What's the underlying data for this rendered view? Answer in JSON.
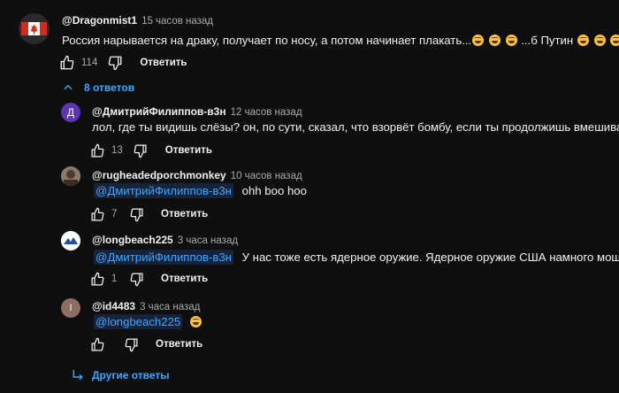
{
  "top_comment": {
    "author": "@Dragonmist1",
    "time": "15 часов назад",
    "text": "Россия нарывается на драку, получает по носу, а потом начинает плакать...",
    "text_tail": "...б Путин",
    "likes": "114",
    "reply_label": "Ответить",
    "avatar_icon": "canada-flag-avatar",
    "toggle_replies_label": "8 ответов"
  },
  "replies": [
    {
      "author": "@ДмитрийФилиппов-в3н",
      "time": "12 часов назад",
      "avatar_letter": "Д",
      "avatar_color": "#5e35b1",
      "mention": "",
      "text": "лол, где ты видишь слёзы? он, по сути, сказал, что взорвёт бомбу, если ты продолжишь вмешиваться",
      "likes": "13",
      "reply_label": "Ответить"
    },
    {
      "author": "@rugheadedporchmonkey",
      "time": "10 часов назад",
      "avatar_icon": "photo-avatar",
      "mention": "@ДмитрийФилиппов-в3н",
      "text": "ohh boo hoo",
      "likes": "7",
      "reply_label": "Ответить"
    },
    {
      "author": "@longbeach225",
      "time": "3 часа назад",
      "avatar_icon": "mountain-logo-avatar",
      "mention": "@ДмитрийФилиппов-в3н",
      "text": "У нас тоже есть ядерное оружие. Ядерное оружие США намного мощнее!",
      "likes": "1",
      "reply_label": "Ответить"
    },
    {
      "author": "@id4483",
      "time": "3 часа назад",
      "avatar_letter": "I",
      "avatar_color": "#8d6e63",
      "mention": "@longbeach225",
      "text": "",
      "likes": "",
      "reply_label": "Ответить"
    }
  ],
  "more_replies_label": "Другие ответы",
  "colors": {
    "background": "#0f0f0f",
    "link": "#3ea6ff",
    "muted": "#aaaaaa"
  }
}
